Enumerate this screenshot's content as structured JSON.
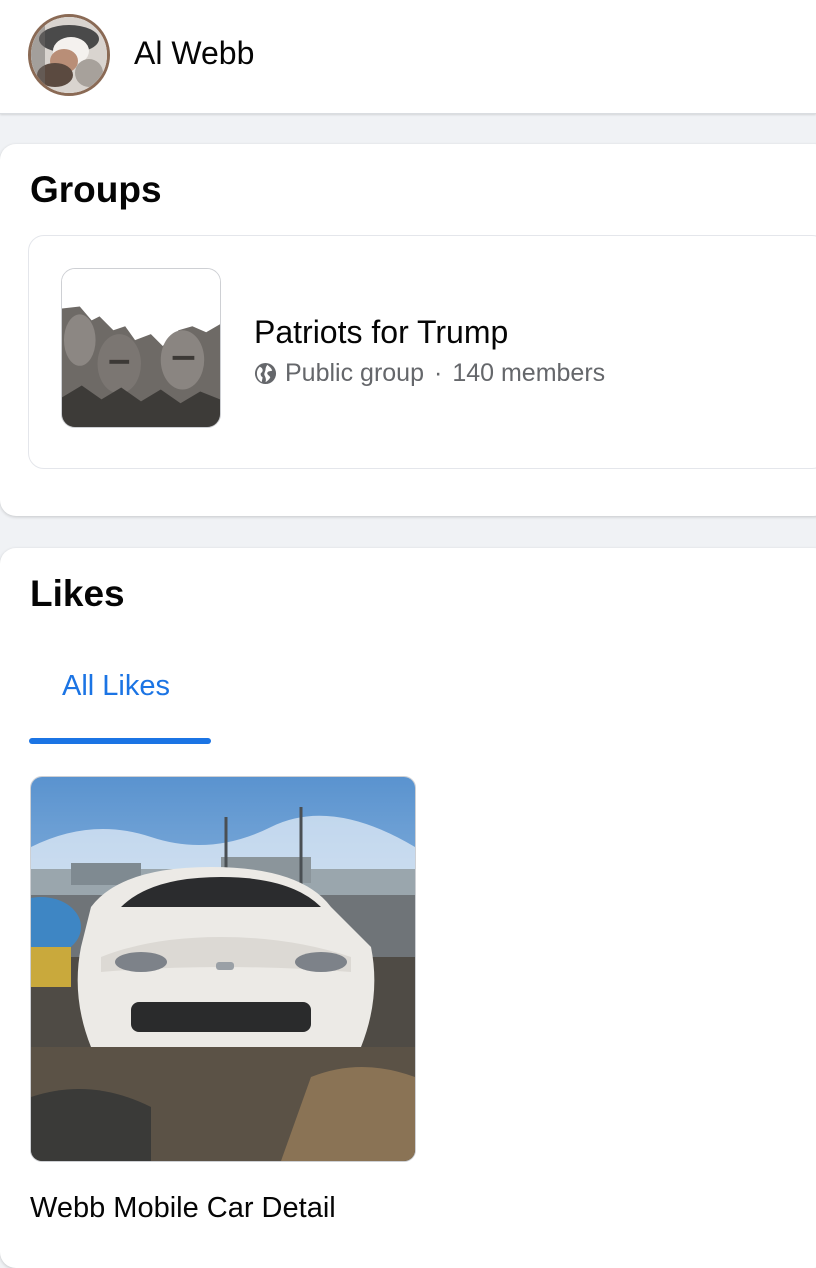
{
  "profile": {
    "name": "Al Webb",
    "avatar_icon": "profile-photo"
  },
  "groups": {
    "title": "Groups",
    "items": [
      {
        "name": "Patriots for Trump",
        "privacy": "Public group",
        "separator": "·",
        "members": "140 members",
        "privacy_icon": "globe-icon",
        "thumbnail": "mount-rushmore-photo"
      }
    ]
  },
  "likes": {
    "title": "Likes",
    "tabs": [
      {
        "label": "All Likes",
        "active": true
      }
    ],
    "items": [
      {
        "name": "Webb Mobile Car Detail",
        "thumbnail": "white-sports-car-photo"
      }
    ]
  },
  "colors": {
    "accent": "#1b74e4",
    "secondary_text": "#65676b",
    "background": "#f0f2f5"
  }
}
